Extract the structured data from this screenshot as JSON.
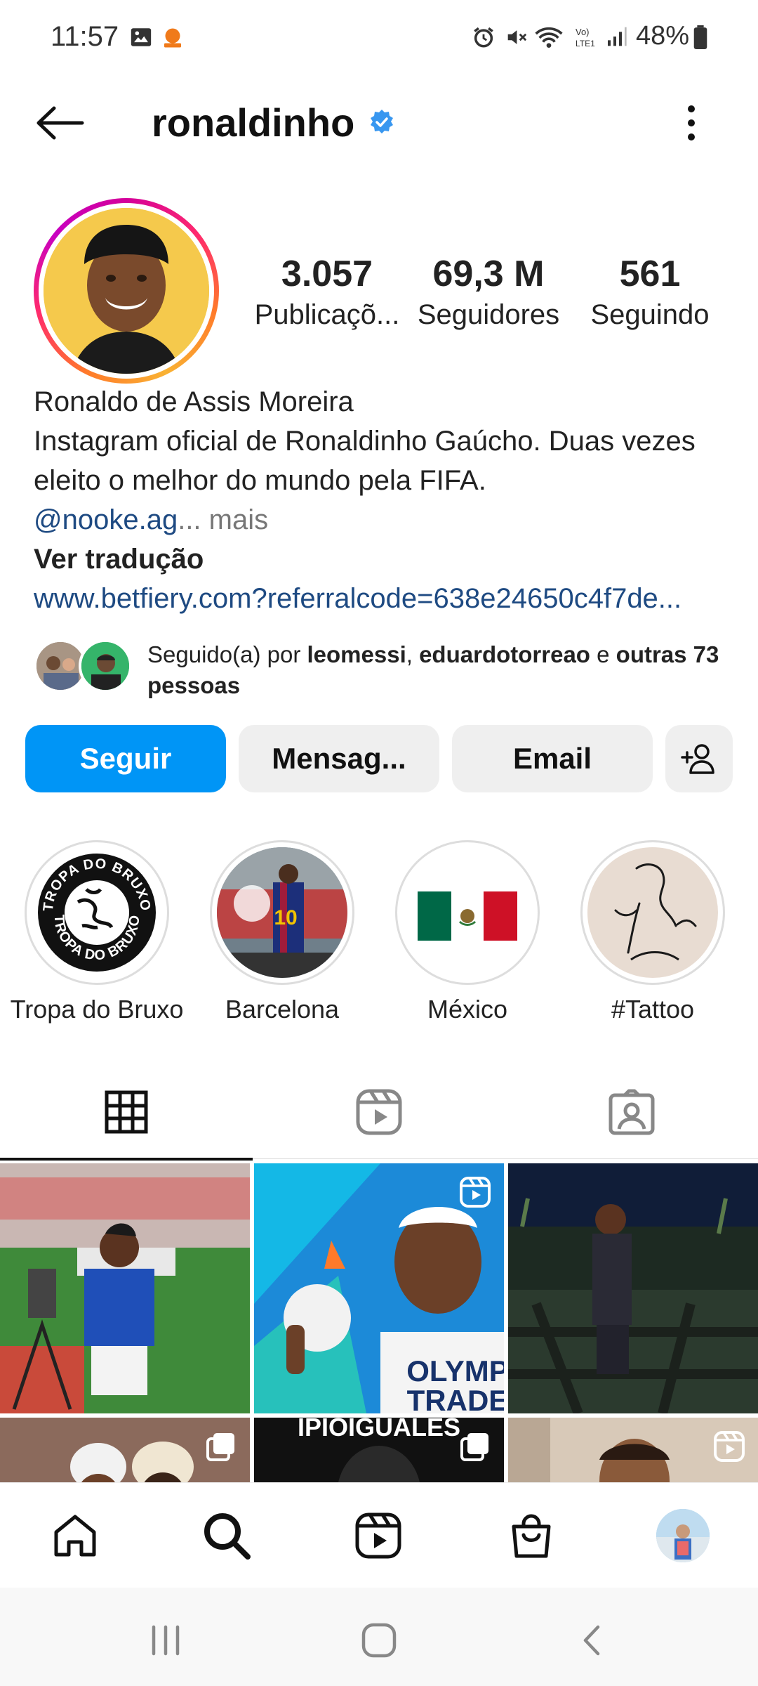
{
  "status_bar": {
    "time": "11:57",
    "battery": "48%"
  },
  "header": {
    "username": "ronaldinho"
  },
  "profile": {
    "stats": [
      {
        "value": "3.057",
        "label": "Publicaçõ..."
      },
      {
        "value": "69,3 M",
        "label": "Seguidores"
      },
      {
        "value": "561",
        "label": "Seguindo"
      }
    ],
    "full_name": "Ronaldo de Assis Moreira",
    "bio_line1": "Instagram oficial de Ronaldinho Gaúcho. Duas vezes",
    "bio_line2": "eleito o melhor do mundo pela FIFA.",
    "mention": "@nooke.ag",
    "ellipsis": "...",
    "more": "mais",
    "see_translation": "Ver tradução",
    "website": "www.betfiery.com?referralcode=638e24650c4f7de...",
    "followed_by": {
      "prefix": "Seguido(a) por ",
      "user1": "leomessi",
      "sep": ", ",
      "user2": "eduardotorreao",
      "and": " e ",
      "others": "outras 73 pessoas"
    }
  },
  "actions": {
    "follow": "Seguir",
    "message": "Mensag...",
    "email": "Email"
  },
  "highlights": [
    {
      "label": "Tropa do Bruxo",
      "badge_text": "TROPA DO BRUXO"
    },
    {
      "label": "Barcelona"
    },
    {
      "label": "México"
    },
    {
      "label": "#Tattoo"
    }
  ],
  "post_overlay_text": {
    "olymp": "OLYMP",
    "trade": "TRADE",
    "iguales": "IPIOIGUALES"
  },
  "colors": {
    "accent": "#0095f6",
    "link": "#1e4a82",
    "verified": "#3897f0"
  }
}
